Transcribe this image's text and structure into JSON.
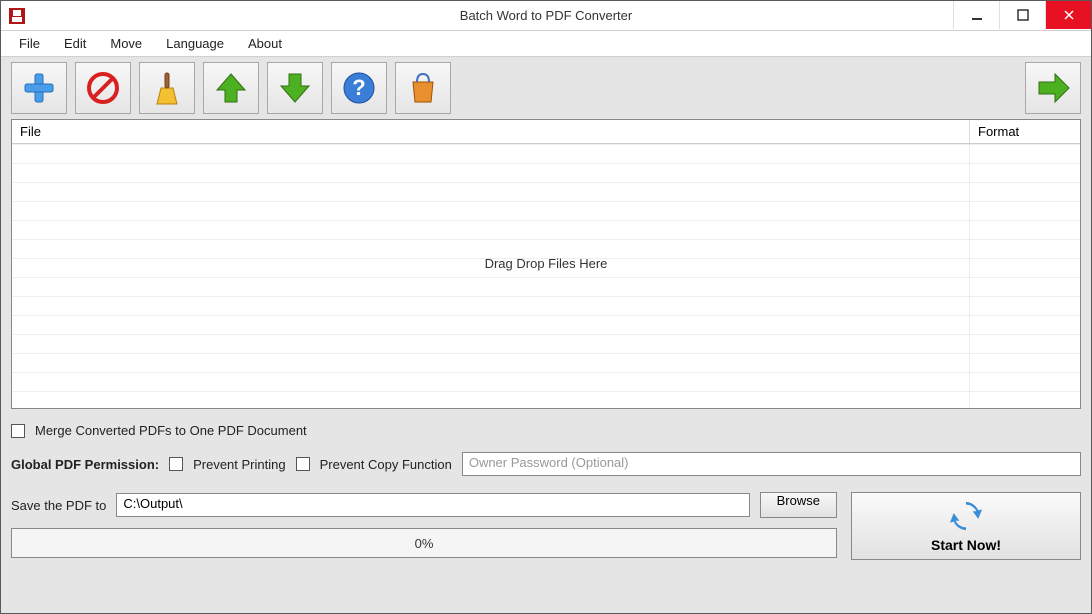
{
  "title": "Batch Word to PDF Converter",
  "menu": [
    "File",
    "Edit",
    "Move",
    "Language",
    "About"
  ],
  "grid": {
    "col_file": "File",
    "col_format": "Format",
    "drop_hint": "Drag  Drop Files Here"
  },
  "merge_label": "Merge Converted PDFs to One PDF Document",
  "permission": {
    "label": "Global PDF Permission:",
    "prevent_print": "Prevent Printing",
    "prevent_copy": "Prevent Copy Function",
    "password_placeholder": "Owner Password (Optional)"
  },
  "save": {
    "label": "Save the PDF to",
    "path": "C:\\Output\\",
    "browse": "Browse"
  },
  "progress": "0%",
  "start": "Start Now!"
}
